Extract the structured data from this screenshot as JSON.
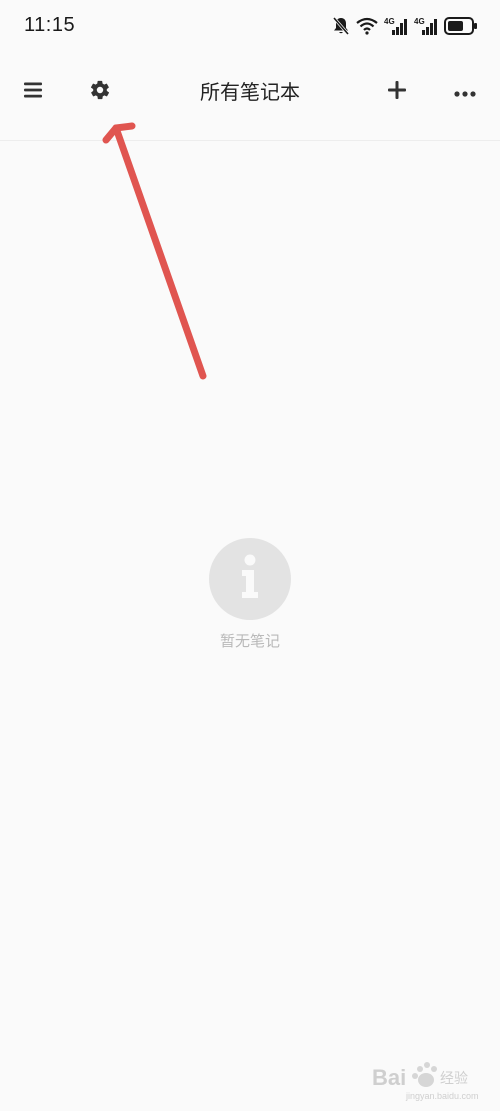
{
  "status_bar": {
    "time": "11:15",
    "icons": [
      "bell-off-icon",
      "wifi-icon",
      "signal-4g-icon",
      "signal-4g-icon",
      "battery-icon"
    ],
    "network_label_1": "4G",
    "network_label_2": "4G",
    "battery_level_percent": 70
  },
  "toolbar": {
    "title": "所有笔记本",
    "left_icons": [
      "menu-icon",
      "gear-icon"
    ],
    "right_icons": [
      "plus-icon",
      "more-icon"
    ]
  },
  "empty_state": {
    "icon": "info-icon",
    "message": "暂无笔记"
  },
  "annotation": {
    "type": "arrow",
    "color": "#e05550",
    "points_to": "gear-icon"
  },
  "watermark": {
    "brand": "Bai",
    "brand_suffix": "经验",
    "url": "jingyan.baidu.com"
  },
  "colors": {
    "background": "#fafafa",
    "icon": "#333333",
    "empty_circle": "#e3e3e3",
    "empty_text": "#b9b9b9"
  }
}
